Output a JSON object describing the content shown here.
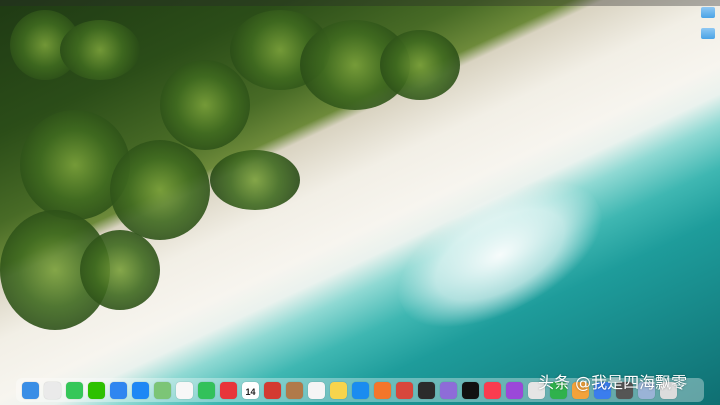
{
  "desktop": {
    "icons": [
      {
        "icon": "folder-icon"
      },
      {
        "icon": "folder-icon"
      }
    ]
  },
  "dock": {
    "items": [
      {
        "icon": "finder-icon",
        "color": "#3a8ee6"
      },
      {
        "icon": "launchpad-icon",
        "color": "#eaeaea"
      },
      {
        "icon": "messages-icon",
        "color": "#35c759"
      },
      {
        "icon": "wechat-icon",
        "color": "#2dc100"
      },
      {
        "icon": "mail-icon",
        "color": "#2f86f0"
      },
      {
        "icon": "app-store-icon",
        "color": "#1e88f5"
      },
      {
        "icon": "maps-icon",
        "color": "#7cc576"
      },
      {
        "icon": "photos-icon",
        "color": "#f7f7f7"
      },
      {
        "icon": "facetime-icon",
        "color": "#32c15a"
      },
      {
        "icon": "audio-app-icon",
        "color": "#e8353b"
      },
      {
        "icon": "calendar-icon",
        "color": "#ffffff",
        "day": "14"
      },
      {
        "icon": "netease-music-icon",
        "color": "#d33a31"
      },
      {
        "icon": "contacts-icon",
        "color": "#b07a4a"
      },
      {
        "icon": "reminders-icon",
        "color": "#f5f5f5"
      },
      {
        "icon": "notes-icon",
        "color": "#f7d44c"
      },
      {
        "icon": "safari-icon",
        "color": "#1a8cf0"
      },
      {
        "icon": "firefox-icon",
        "color": "#f4762a"
      },
      {
        "icon": "remote-desktop-icon",
        "color": "#d8473c"
      },
      {
        "icon": "terminal-icon",
        "color": "#2b2b2b"
      },
      {
        "icon": "app-icon",
        "color": "#8e6cd8"
      },
      {
        "icon": "apple-tv-icon",
        "color": "#111111"
      },
      {
        "icon": "music-icon",
        "color": "#fa3c4f"
      },
      {
        "icon": "podcasts-icon",
        "color": "#9b48d9"
      },
      {
        "icon": "app-icon",
        "color": "#e5e5e5"
      },
      {
        "icon": "numbers-icon",
        "color": "#2fb24c"
      },
      {
        "icon": "pages-icon",
        "color": "#f3a23a"
      },
      {
        "icon": "keynote-icon",
        "color": "#3b7ded"
      },
      {
        "icon": "app-icon",
        "color": "#555555"
      },
      {
        "icon": "app-icon",
        "color": "#9ab3d6"
      },
      {
        "icon": "trash-icon",
        "color": "#dcdcdc"
      }
    ]
  },
  "watermark": {
    "text": "头条 @我是四海飘零"
  }
}
